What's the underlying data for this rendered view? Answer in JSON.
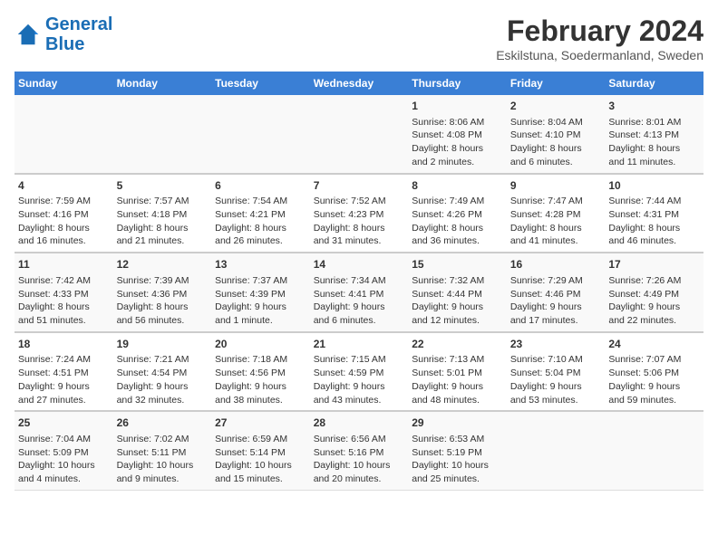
{
  "header": {
    "logo_line1": "General",
    "logo_line2": "Blue",
    "month_year": "February 2024",
    "location": "Eskilstuna, Soedermanland, Sweden"
  },
  "weekdays": [
    "Sunday",
    "Monday",
    "Tuesday",
    "Wednesday",
    "Thursday",
    "Friday",
    "Saturday"
  ],
  "weeks": [
    [
      {
        "day": "",
        "content": ""
      },
      {
        "day": "",
        "content": ""
      },
      {
        "day": "",
        "content": ""
      },
      {
        "day": "",
        "content": ""
      },
      {
        "day": "1",
        "content": "Sunrise: 8:06 AM\nSunset: 4:08 PM\nDaylight: 8 hours\nand 2 minutes."
      },
      {
        "day": "2",
        "content": "Sunrise: 8:04 AM\nSunset: 4:10 PM\nDaylight: 8 hours\nand 6 minutes."
      },
      {
        "day": "3",
        "content": "Sunrise: 8:01 AM\nSunset: 4:13 PM\nDaylight: 8 hours\nand 11 minutes."
      }
    ],
    [
      {
        "day": "4",
        "content": "Sunrise: 7:59 AM\nSunset: 4:16 PM\nDaylight: 8 hours\nand 16 minutes."
      },
      {
        "day": "5",
        "content": "Sunrise: 7:57 AM\nSunset: 4:18 PM\nDaylight: 8 hours\nand 21 minutes."
      },
      {
        "day": "6",
        "content": "Sunrise: 7:54 AM\nSunset: 4:21 PM\nDaylight: 8 hours\nand 26 minutes."
      },
      {
        "day": "7",
        "content": "Sunrise: 7:52 AM\nSunset: 4:23 PM\nDaylight: 8 hours\nand 31 minutes."
      },
      {
        "day": "8",
        "content": "Sunrise: 7:49 AM\nSunset: 4:26 PM\nDaylight: 8 hours\nand 36 minutes."
      },
      {
        "day": "9",
        "content": "Sunrise: 7:47 AM\nSunset: 4:28 PM\nDaylight: 8 hours\nand 41 minutes."
      },
      {
        "day": "10",
        "content": "Sunrise: 7:44 AM\nSunset: 4:31 PM\nDaylight: 8 hours\nand 46 minutes."
      }
    ],
    [
      {
        "day": "11",
        "content": "Sunrise: 7:42 AM\nSunset: 4:33 PM\nDaylight: 8 hours\nand 51 minutes."
      },
      {
        "day": "12",
        "content": "Sunrise: 7:39 AM\nSunset: 4:36 PM\nDaylight: 8 hours\nand 56 minutes."
      },
      {
        "day": "13",
        "content": "Sunrise: 7:37 AM\nSunset: 4:39 PM\nDaylight: 9 hours\nand 1 minute."
      },
      {
        "day": "14",
        "content": "Sunrise: 7:34 AM\nSunset: 4:41 PM\nDaylight: 9 hours\nand 6 minutes."
      },
      {
        "day": "15",
        "content": "Sunrise: 7:32 AM\nSunset: 4:44 PM\nDaylight: 9 hours\nand 12 minutes."
      },
      {
        "day": "16",
        "content": "Sunrise: 7:29 AM\nSunset: 4:46 PM\nDaylight: 9 hours\nand 17 minutes."
      },
      {
        "day": "17",
        "content": "Sunrise: 7:26 AM\nSunset: 4:49 PM\nDaylight: 9 hours\nand 22 minutes."
      }
    ],
    [
      {
        "day": "18",
        "content": "Sunrise: 7:24 AM\nSunset: 4:51 PM\nDaylight: 9 hours\nand 27 minutes."
      },
      {
        "day": "19",
        "content": "Sunrise: 7:21 AM\nSunset: 4:54 PM\nDaylight: 9 hours\nand 32 minutes."
      },
      {
        "day": "20",
        "content": "Sunrise: 7:18 AM\nSunset: 4:56 PM\nDaylight: 9 hours\nand 38 minutes."
      },
      {
        "day": "21",
        "content": "Sunrise: 7:15 AM\nSunset: 4:59 PM\nDaylight: 9 hours\nand 43 minutes."
      },
      {
        "day": "22",
        "content": "Sunrise: 7:13 AM\nSunset: 5:01 PM\nDaylight: 9 hours\nand 48 minutes."
      },
      {
        "day": "23",
        "content": "Sunrise: 7:10 AM\nSunset: 5:04 PM\nDaylight: 9 hours\nand 53 minutes."
      },
      {
        "day": "24",
        "content": "Sunrise: 7:07 AM\nSunset: 5:06 PM\nDaylight: 9 hours\nand 59 minutes."
      }
    ],
    [
      {
        "day": "25",
        "content": "Sunrise: 7:04 AM\nSunset: 5:09 PM\nDaylight: 10 hours\nand 4 minutes."
      },
      {
        "day": "26",
        "content": "Sunrise: 7:02 AM\nSunset: 5:11 PM\nDaylight: 10 hours\nand 9 minutes."
      },
      {
        "day": "27",
        "content": "Sunrise: 6:59 AM\nSunset: 5:14 PM\nDaylight: 10 hours\nand 15 minutes."
      },
      {
        "day": "28",
        "content": "Sunrise: 6:56 AM\nSunset: 5:16 PM\nDaylight: 10 hours\nand 20 minutes."
      },
      {
        "day": "29",
        "content": "Sunrise: 6:53 AM\nSunset: 5:19 PM\nDaylight: 10 hours\nand 25 minutes."
      },
      {
        "day": "",
        "content": ""
      },
      {
        "day": "",
        "content": ""
      }
    ]
  ]
}
